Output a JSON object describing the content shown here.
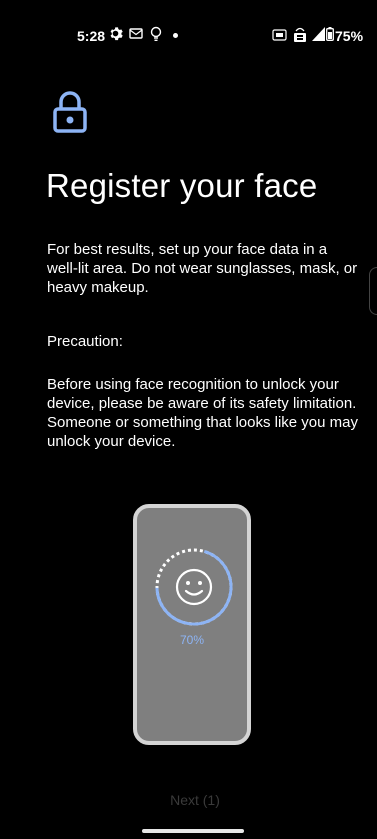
{
  "status_bar": {
    "time": "5:28",
    "battery_percent": "75%",
    "icons": [
      "gear-icon",
      "message-icon",
      "lightbulb-icon",
      "dot-icon",
      "nfc-icon",
      "volte-icon",
      "signal-icon",
      "battery-icon"
    ]
  },
  "header": {
    "icon": "lock-icon",
    "title": "Register your face"
  },
  "content": {
    "paragraph1": "For best results, set up your face data in a well-lit area. Do not wear sunglasses, mask, or heavy makeup.",
    "paragraph2": "Precaution:",
    "paragraph3": "Before using face recognition to unlock your device, please be aware of its safety limitation. Someone or something that looks like you may unlock your device."
  },
  "illustration": {
    "icon": "smiley-face-icon",
    "progress_label": "70%",
    "progress_fraction": 0.7,
    "progress_color": "#8db4f5"
  },
  "footer": {
    "next_label": "Next (1)"
  },
  "colors": {
    "background": "#000000",
    "accent": "#8db4f5",
    "phone_body": "#7f7f7f",
    "phone_border": "#d4d4d4"
  }
}
